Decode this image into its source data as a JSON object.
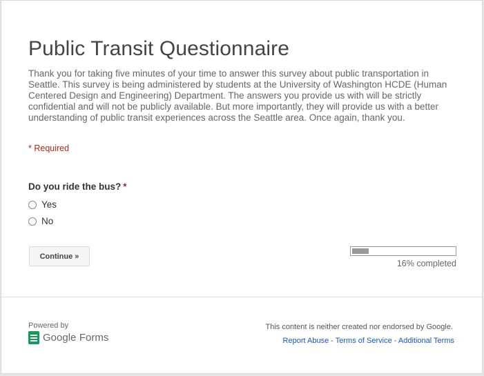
{
  "form": {
    "title": "Public Transit Questionnaire",
    "description": "Thank you for taking five minutes of your time to answer this survey about public transportation in Seattle. This survey is being administered by students at the University of Washington HCDE (Human Centered Design and Engineering) Department. The answers you provide us with will be strictly confidential and will not be publicly available. But more importantly, they will provide us with a better understanding of public transit experiences across the Seattle area. Once again, thank you.",
    "required_note": "* Required"
  },
  "question": {
    "label": "Do you ride the bus?",
    "required_star": "*",
    "options": [
      "Yes",
      "No"
    ]
  },
  "actions": {
    "continue_label": "Continue »"
  },
  "progress": {
    "fraction": 0.16,
    "label": "16% completed"
  },
  "footer": {
    "powered_by": "Powered by",
    "brand_google": "Google",
    "brand_forms": "Forms",
    "disclaimer": "This content is neither created nor endorsed by Google.",
    "links": [
      "Report Abuse",
      "Terms of Service",
      "Additional Terms"
    ],
    "link_separator": " - "
  },
  "colors": {
    "required": "#a7291d",
    "link": "#15c",
    "forms_green": "#0f9d58"
  },
  "icons": {
    "forms_logo": "google-forms-icon"
  }
}
